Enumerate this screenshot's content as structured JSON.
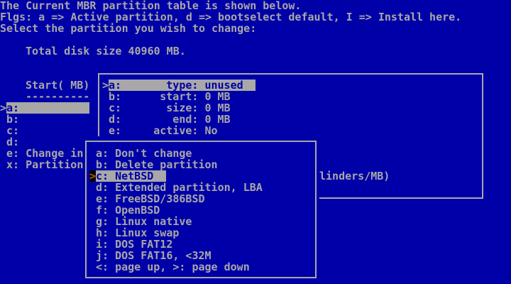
{
  "screen": {
    "colors": {
      "background": "#0000A8",
      "text": "#A8A8A8",
      "highlight_bg": "#A8A8A8",
      "highlight_text": "#0000A8",
      "cursor_arrow": "#B45A00",
      "cursor_cell_bg": "#000000"
    },
    "header": {
      "line1": "The Current MBR partition table is shown below.",
      "line2": "Flgs: a => Active partition, d => bootselect default, I => Install here.",
      "line3": "Select the partition you wish to change:"
    },
    "disk_info": "Total disk size 40960 MB.",
    "partition_list": {
      "column_header": "Start( MB)",
      "header_underline": "----------",
      "pointer": ">",
      "items": [
        {
          "key": "a",
          "label": "a:",
          "selected": true
        },
        {
          "key": "b",
          "label": "b:"
        },
        {
          "key": "c",
          "label": "c:"
        },
        {
          "key": "d",
          "label": "d:"
        },
        {
          "key": "e",
          "label": "e: Change in",
          "note": "truncated by overlay window"
        },
        {
          "key": "x",
          "label": "x: Partition",
          "note": "truncated by overlay window"
        }
      ]
    },
    "partition_detail_window": {
      "pointer": ">",
      "rows": [
        {
          "key": "a",
          "label": "a:       type: unused",
          "selected": true
        },
        {
          "key": "b",
          "label": "b:      start: 0 MB"
        },
        {
          "key": "c",
          "label": "c:       size: 0 MB"
        },
        {
          "key": "d",
          "label": "d:        end: 0 MB"
        },
        {
          "key": "e",
          "label": "e:     active: No"
        }
      ],
      "partial_units_text": "linders/MB)"
    },
    "type_menu": {
      "pointer": ">",
      "items": [
        {
          "key": "a",
          "label": "a: Don't change"
        },
        {
          "key": "b",
          "label": "b: Delete partition"
        },
        {
          "key": "c",
          "label": "c: NetBSD",
          "selected": true
        },
        {
          "key": "d",
          "label": "d: Extended partition, LBA"
        },
        {
          "key": "e",
          "label": "e: FreeBSD/386BSD"
        },
        {
          "key": "f",
          "label": "f: OpenBSD"
        },
        {
          "key": "g",
          "label": "g: Linux native"
        },
        {
          "key": "h",
          "label": "h: Linux swap"
        },
        {
          "key": "i",
          "label": "i: DOS FAT12"
        },
        {
          "key": "j",
          "label": "j: DOS FAT16, <32M"
        },
        {
          "key": "nav",
          "label": "<: page up, >: page down"
        }
      ]
    }
  }
}
